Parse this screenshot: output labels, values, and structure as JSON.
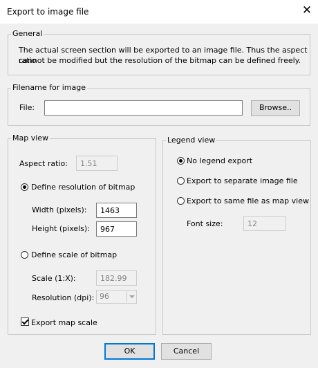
{
  "window": {
    "title": "Export to image file",
    "close_glyph": "✕"
  },
  "general": {
    "label": "General",
    "description_line1": "The actual screen section will be exported to an image file.  Thus the aspect ratio",
    "description_line2": "cannot be modified but the resolution of the bitmap can be defined freely."
  },
  "filename": {
    "label": "Filename for image",
    "file_label": "File:",
    "file_value": "",
    "browse_label": "Browse.."
  },
  "map_view": {
    "label": "Map view",
    "aspect_label": "Aspect ratio:",
    "aspect_value": "1.51",
    "define_resolution_label": "Define resolution of bitmap",
    "define_resolution_selected": true,
    "width_label": "Width (pixels):",
    "width_value": "1463",
    "height_label": "Height (pixels):",
    "height_value": "967",
    "define_scale_label": "Define scale of bitmap",
    "define_scale_selected": false,
    "scale_label": "Scale (1:X):",
    "scale_value": "182.99",
    "resolution_label": "Resolution (dpi):",
    "resolution_value": "96",
    "export_scale_label": "Export map scale",
    "export_scale_checked": true
  },
  "legend_view": {
    "label": "Legend view",
    "no_legend_label": "No legend export",
    "separate_label": "Export to separate image file",
    "same_file_label": "Export to same file as map view",
    "font_size_label": "Font size:",
    "font_size_value": "12"
  },
  "buttons": {
    "ok_label": "OK",
    "cancel_label": "Cancel"
  }
}
